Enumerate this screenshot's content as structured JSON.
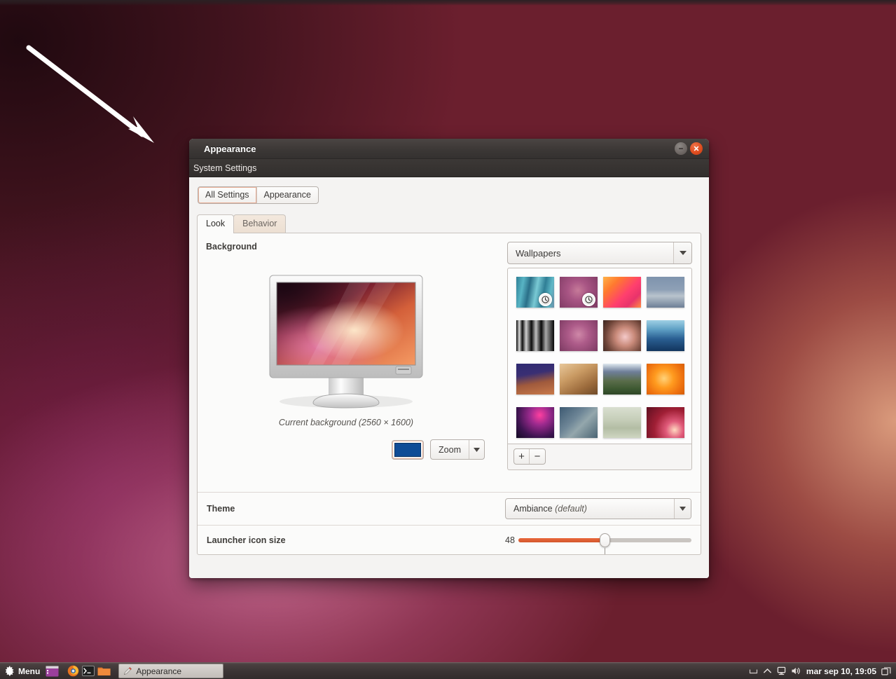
{
  "desktop": {
    "annotation_arrow": "white-arrow-pointing-to-window"
  },
  "window": {
    "title": "Appearance",
    "subtitle": "System Settings",
    "controls": {
      "minimize": "minimize-button",
      "close": "close-button"
    },
    "nav": {
      "all_settings": "All Settings",
      "current": "Appearance"
    },
    "tabs": [
      {
        "label": "Look",
        "active": true
      },
      {
        "label": "Behavior",
        "active": false
      }
    ],
    "background": {
      "section_title": "Background",
      "preview_caption": "Current background (2560 × 1600)",
      "color_swatch": "#0f4c96",
      "scaling_mode": "Zoom",
      "source": "Wallpapers",
      "add_label": "+",
      "remove_label": "−",
      "wallpapers": [
        {
          "name": "teal-stripes",
          "css": "linear-gradient(100deg,#2e7f96 0%,#58b4c4 18%,#2a6f88 34%,#79c9d4 52%,#2f7e95 70%,#5fb9c8 86%,#6b8fa8 100%)",
          "badge": true
        },
        {
          "name": "purple-bug",
          "css": "radial-gradient(circle at 48% 44%, #c67a99 0%, #a85584 38%, #7e3a63 100%)",
          "badge": true
        },
        {
          "name": "orange-flower",
          "css": "linear-gradient(135deg,#ffb347 0%,#ff7a2f 26%,#ff3f6e 58%,#e8336b 78%,#ff8c42 100%)",
          "badge": false
        },
        {
          "name": "blue-gray-mountain",
          "css": "linear-gradient(180deg,#7e93ad 0%,#8ea0b6 42%,#b9c3cd 62%,#6d7f96 100%)",
          "badge": false
        },
        {
          "name": "bw-architecture",
          "css": "linear-gradient(90deg,#0a0a0a 0%,#dcdcdc 8%,#101010 16%,#cfcfcf 26%,#0c0c0c 40%,#bfbfbf 52%,#090909 66%,#a8a8a8 78%,#060606 100%)",
          "badge": false
        },
        {
          "name": "purple-bug-2",
          "css": "radial-gradient(circle at 50% 46%, #cf88a8 0%, #ad5b89 40%, #7c3a62 100%)",
          "badge": false
        },
        {
          "name": "cherry-blossom",
          "css": "radial-gradient(circle at 58% 54%, #f4c9c9 0%, #c98a7a 34%, #6d4438 72%, #3b2620 100%)",
          "badge": false
        },
        {
          "name": "blue-sea-sky",
          "css": "linear-gradient(180deg,#9fd0e4 0%,#5e9fc4 30%,#2a5f92 60%,#12355e 100%)",
          "badge": false
        },
        {
          "name": "purple-rock",
          "css": "linear-gradient(170deg,#2e2a72 0%,#3a2f73 34%,#a05a3c 62%,#c8794a 100%)",
          "badge": false
        },
        {
          "name": "golden-wheat",
          "css": "linear-gradient(150deg,#e8c79a 0%,#c99a63 38%,#9c6b3c 72%,#6f4a28 100%)",
          "badge": false
        },
        {
          "name": "green-mountain",
          "css": "linear-gradient(180deg,#dfe8ef 0%,#6f7f9a 26%,#5a6d4a 56%,#3f5a33 80%,#2e4726 100%)",
          "badge": false
        },
        {
          "name": "orange-abstract",
          "css": "radial-gradient(circle at 46% 48%, #ffd27a 0%, #ff9b1f 36%, #ef7310 70%, #d45c08 100%)",
          "badge": false
        },
        {
          "name": "magenta-particles",
          "css": "radial-gradient(circle at 62% 26%, #ff3fa0 0%, #9c2a8e 30%, #3d1450 68%, #120a22 100%)",
          "badge": false
        },
        {
          "name": "blue-gray-diagonal",
          "css": "linear-gradient(135deg,#3d5a72 0%,#6d8596 38%,#94a7ac 58%,#4a6473 100%)",
          "badge": false
        },
        {
          "name": "misty-field",
          "css": "linear-gradient(180deg,#d9dfd0 0%,#c5cdb8 42%,#b3bda4 68%,#cfd6c2 100%)",
          "badge": false
        },
        {
          "name": "red-ubuntu",
          "css": "radial-gradient(circle at 74% 74%, #ffd9c0 0%, #e05a7a 24%, #a01f35 56%, #5e0f20 100%)",
          "badge": false
        }
      ]
    },
    "theme": {
      "label": "Theme",
      "value": "Ambiance",
      "value_suffix": "(default)"
    },
    "launcher": {
      "label": "Launcher icon size",
      "value": "48",
      "percent": 50
    }
  },
  "taskbar": {
    "menu_label": "Menu",
    "launchers": [
      {
        "name": "terminal-window-icon"
      },
      {
        "name": "firefox-icon"
      },
      {
        "name": "terminal-icon"
      },
      {
        "name": "files-folder-icon"
      }
    ],
    "task": {
      "label": "Appearance",
      "icon": "appearance-icon"
    },
    "tray": [
      {
        "name": "hide-panel-icon"
      },
      {
        "name": "chevron-up-icon"
      },
      {
        "name": "display-icon"
      },
      {
        "name": "volume-icon"
      }
    ],
    "clock": "mar sep 10, 19:05",
    "workspace_icon": "workspace-switcher-icon"
  }
}
